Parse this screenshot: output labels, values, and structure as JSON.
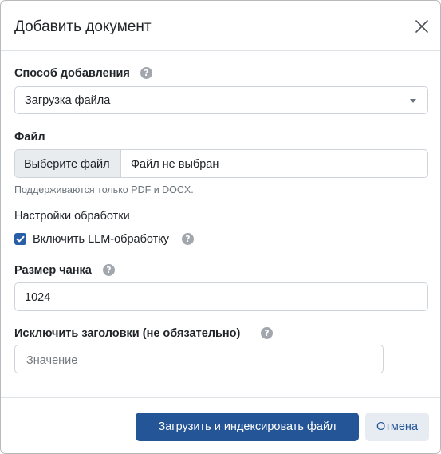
{
  "modal": {
    "title": "Добавить документ"
  },
  "method": {
    "label": "Способ добавления",
    "help_icon": "?",
    "selected": "Загрузка файла"
  },
  "file": {
    "label": "Файл",
    "choose_button": "Выберите файл",
    "status": "Файл не выбран",
    "hint": "Поддерживаются только PDF и DOCX."
  },
  "processing": {
    "label": "Настройки обработки",
    "llm_checkbox_label": "Включить LLM-обработку",
    "llm_checked": true,
    "help_icon": "?"
  },
  "chunk": {
    "label": "Размер чанка",
    "help_icon": "?",
    "value": "1024"
  },
  "exclude_headers": {
    "label": "Исключить заголовки (не обязательно)",
    "help_icon": "?",
    "placeholder": "Значение"
  },
  "footer": {
    "submit_label": "Загрузить и индексировать файл",
    "cancel_label": "Отмена"
  },
  "colors": {
    "primary": "#245596",
    "checkbox": "#2a5ea6",
    "help_icon": "#a2a7ad"
  },
  "icons": {
    "close": "close-icon",
    "help": "question-circle-icon",
    "caret": "caret-down-icon",
    "check": "check-icon"
  }
}
